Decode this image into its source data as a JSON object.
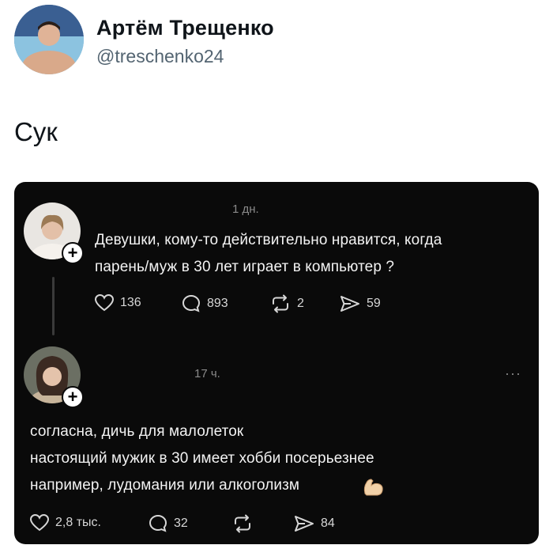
{
  "author": {
    "name": "Артём Трещенко",
    "handle": "@treschenko24"
  },
  "tweet": {
    "text": "Сук"
  },
  "embed": {
    "post1": {
      "time": "1 дн.",
      "lines": [
        "Девушки, кому-то действительно нравится, когда",
        "парень/муж в 30 лет играет в компьютер ?"
      ],
      "actions": {
        "likes": "136",
        "comments": "893",
        "reposts": "2",
        "shares": "59"
      }
    },
    "post2": {
      "time": "17 ч.",
      "more": "···",
      "lines": [
        "согласна, дичь для малолеток",
        "настоящий мужик в 30 имеет хобби посерьезнее",
        "например, лудомания или алкоголизм"
      ],
      "actions": {
        "likes": "2,8 тыс.",
        "comments": "32",
        "shares": "84"
      }
    },
    "icons": [
      "heart-icon",
      "comment-icon",
      "repost-icon",
      "send-icon",
      "plus-icon",
      "more-icon",
      "flexed-biceps-emoji"
    ],
    "colors": {
      "background": "#0a0a0a",
      "text": "#f3f3f3",
      "muted": "#8a8a8a"
    }
  }
}
